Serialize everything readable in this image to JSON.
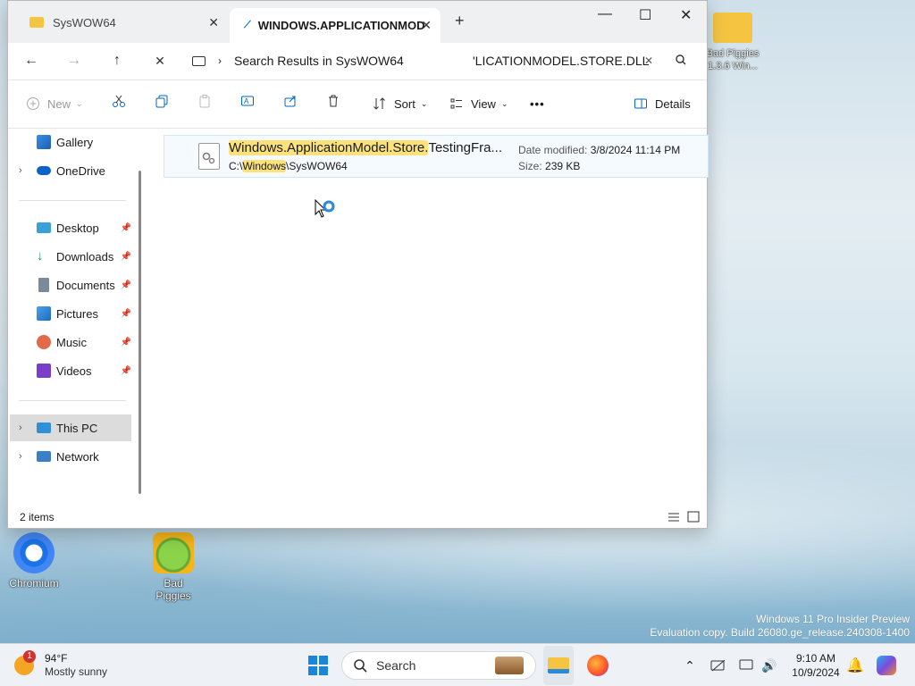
{
  "window": {
    "tabs": [
      {
        "label": "SysWOW64"
      },
      {
        "label": "WINDOWS.APPLICATIONMOD"
      }
    ],
    "new_tab": "+",
    "caption": {
      "minimize": "—",
      "maximize": "☐",
      "close": "✕"
    }
  },
  "navbar": {
    "back": "←",
    "forward": "→",
    "up": "↑",
    "stop": "✕",
    "breadcrumb": "Search Results in SysWOW64",
    "search_value": "'LICATIONMODEL.STORE.DLL",
    "search_clear": "✕"
  },
  "toolbar": {
    "new_label": "New",
    "sort_label": "Sort",
    "view_label": "View",
    "more_label": "•••",
    "details_label": "Details"
  },
  "nav_pane": {
    "gallery": "Gallery",
    "onedrive": "OneDrive",
    "desktop": "Desktop",
    "downloads": "Downloads",
    "documents": "Documents",
    "pictures": "Pictures",
    "music": "Music",
    "videos": "Videos",
    "this_pc": "This PC",
    "network": "Network"
  },
  "results": {
    "file": {
      "name_highlight": "Windows.ApplicationModel.Store.",
      "name_rest": "TestingFra...",
      "path_prefix": "C:\\",
      "path_highlight": "Windows",
      "path_suffix": "\\SysWOW64",
      "date_label": "Date modified:",
      "date_value": "3/8/2024 11:14 PM",
      "size_label": "Size:",
      "size_value": "239 KB"
    }
  },
  "status": {
    "items": "2 items"
  },
  "desktop": {
    "icons": [
      {
        "label": "Chromium"
      },
      {
        "label": "Bad Piggies"
      },
      {
        "label": "Bad Piggies\n1.3.6 Win..."
      }
    ],
    "watermark_line1": "Windows 11 Pro Insider Preview",
    "watermark_line2": "Evaluation copy. Build 26080.ge_release.240308-1400"
  },
  "taskbar": {
    "weather_temp": "94°F",
    "weather_desc": "Mostly sunny",
    "weather_badge": "1",
    "search_label": "Search",
    "time": "9:10 AM",
    "date": "10/9/2024"
  }
}
